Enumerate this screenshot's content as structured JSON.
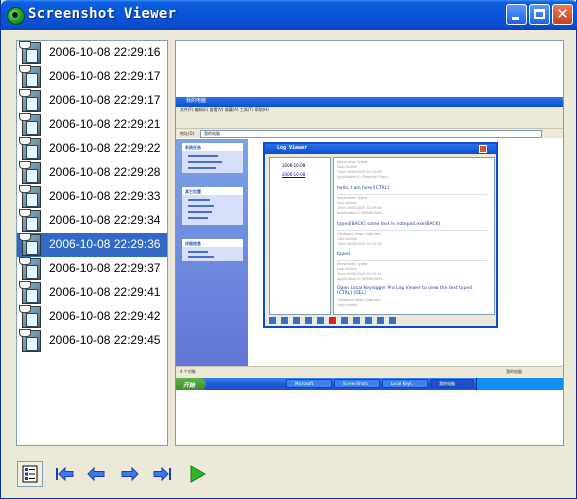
{
  "window": {
    "title": "Screenshot Viewer",
    "accent": "#0a4fcf",
    "selection": "#316ac5"
  },
  "captures": [
    {
      "timestamp": "2006-10-08 22:29:16"
    },
    {
      "timestamp": "2006-10-08 22:29:17"
    },
    {
      "timestamp": "2006-10-08 22:29:17"
    },
    {
      "timestamp": "2006-10-08 22:29:21"
    },
    {
      "timestamp": "2006-10-08 22:29:22"
    },
    {
      "timestamp": "2006-10-08 22:29:28"
    },
    {
      "timestamp": "2006-10-08 22:29:33"
    },
    {
      "timestamp": "2006-10-08 22:29:34"
    },
    {
      "timestamp": "2006-10-08 22:29:36",
      "selected": true
    },
    {
      "timestamp": "2006-10-08 22:29:37"
    },
    {
      "timestamp": "2006-10-08 22:29:41"
    },
    {
      "timestamp": "2006-10-08 22:29:42"
    },
    {
      "timestamp": "2006-10-08 22:29:45"
    }
  ],
  "preview": {
    "explorer_title": "我的电脑",
    "explorer_menu": "文件(F)   编辑(E)   查看(V)   收藏(A)   工具(T)   帮助(H)",
    "address_label": "地址(D)",
    "address_value": "我的电脑",
    "task_sections": [
      "系统任务",
      "其它位置",
      "详细信息"
    ],
    "status_left": "4 个对象",
    "status_right": "我的电脑",
    "start_label": "开始",
    "taskbar_items": [
      "Microsoft",
      "ScreenShots",
      "Local Keyl..",
      "我的电脑"
    ],
    "log_viewer": {
      "title": "Log Viewer",
      "tree": [
        "2006-10-08",
        "2006-10-08"
      ],
      "entries": [
        "hello, I am here![CTRL]",
        "typed[BACK] some text in notepad.exe[BACK]",
        "typed",
        "Open Local Keylogger Pro Log Viewer to view the text typed [CTRL] [DEL]"
      ]
    }
  },
  "toolbar": {
    "buttons": [
      {
        "icon": "thumbnail-view-icon",
        "title": "Thumbnail view"
      },
      {
        "icon": "first-icon",
        "title": "First"
      },
      {
        "icon": "previous-icon",
        "title": "Previous"
      },
      {
        "icon": "next-icon",
        "title": "Next"
      },
      {
        "icon": "last-icon",
        "title": "Last"
      },
      {
        "icon": "play-icon",
        "title": "Play"
      }
    ]
  }
}
